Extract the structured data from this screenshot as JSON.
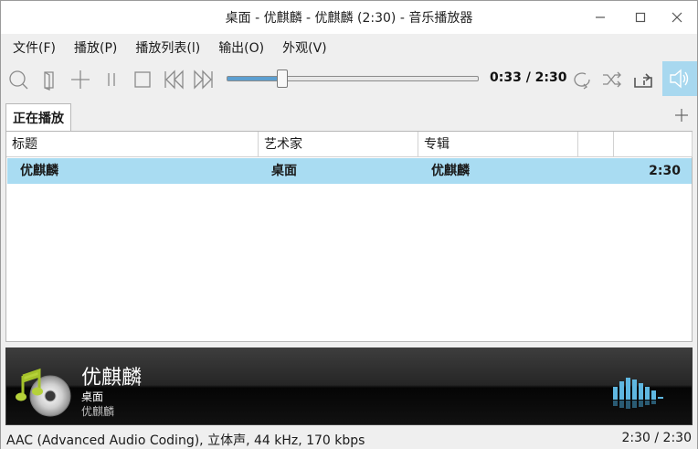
{
  "window": {
    "title": "桌面 - 优麒麟 - 优麒麟 (2:30) - 音乐播放器"
  },
  "menu": {
    "items": [
      {
        "label": "文件(F)"
      },
      {
        "label": "播放(P)"
      },
      {
        "label": "播放列表(l)"
      },
      {
        "label": "输出(O)"
      },
      {
        "label": "外观(V)"
      }
    ]
  },
  "toolbar": {
    "icons": [
      "search-icon",
      "open-file-icon",
      "add-icon",
      "pause-icon",
      "stop-icon",
      "previous-icon",
      "next-icon",
      "repeat-icon",
      "shuffle-icon",
      "repeat-one-icon",
      "volume-icon"
    ],
    "time_display": "0:33 / 2:30",
    "seek_fraction": 0.22,
    "accent_color": "#5c9fd0",
    "volume_active_color": "#a8d8ef"
  },
  "tabs": {
    "active_label": "正在播放"
  },
  "playlist": {
    "columns": [
      "标题",
      "艺术家",
      "专辑",
      "",
      ""
    ],
    "rows": [
      {
        "title": "优麒麟",
        "artist": "桌面",
        "album": "优麒麟",
        "length": "2:30",
        "selected": true
      }
    ],
    "selected_color": "#a9dcf2"
  },
  "now_playing": {
    "title": "优麒麟",
    "artist": "桌面",
    "album": "优麒麟"
  },
  "status": {
    "format_info": "AAC (Advanced Audio Coding), 立体声, 44 kHz, 170 kbps",
    "time": "2:30 / 2:30"
  }
}
